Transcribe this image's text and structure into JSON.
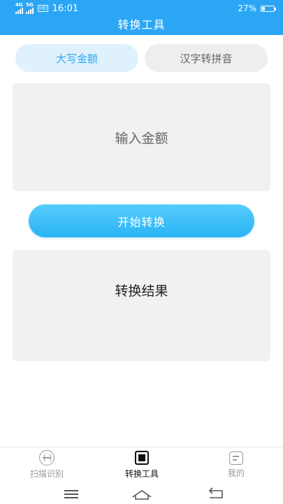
{
  "status_bar": {
    "net_4g": "4G",
    "net_5g": "5G",
    "hd": "HD",
    "time": "16:01",
    "battery_text": "27%",
    "battery_level": 0.27
  },
  "header": {
    "title": "转换工具"
  },
  "tabs": [
    {
      "label": "大写金额",
      "active": true
    },
    {
      "label": "汉字转拼音",
      "active": false
    }
  ],
  "input": {
    "placeholder": "输入金额"
  },
  "convert_button": {
    "label": "开始转换"
  },
  "result": {
    "title": "转换结果"
  },
  "bottom_nav": [
    {
      "label": "扫描识别",
      "icon": "scan-icon",
      "active": false
    },
    {
      "label": "转换工具",
      "icon": "convert-icon",
      "active": true
    },
    {
      "label": "我的",
      "icon": "profile-icon",
      "active": false
    }
  ],
  "colors": {
    "brand": "#2ba6f5",
    "tab_active_bg": "#def1fd",
    "tab_active_text": "#2ea8ee",
    "box_bg": "#f1f1f1"
  }
}
